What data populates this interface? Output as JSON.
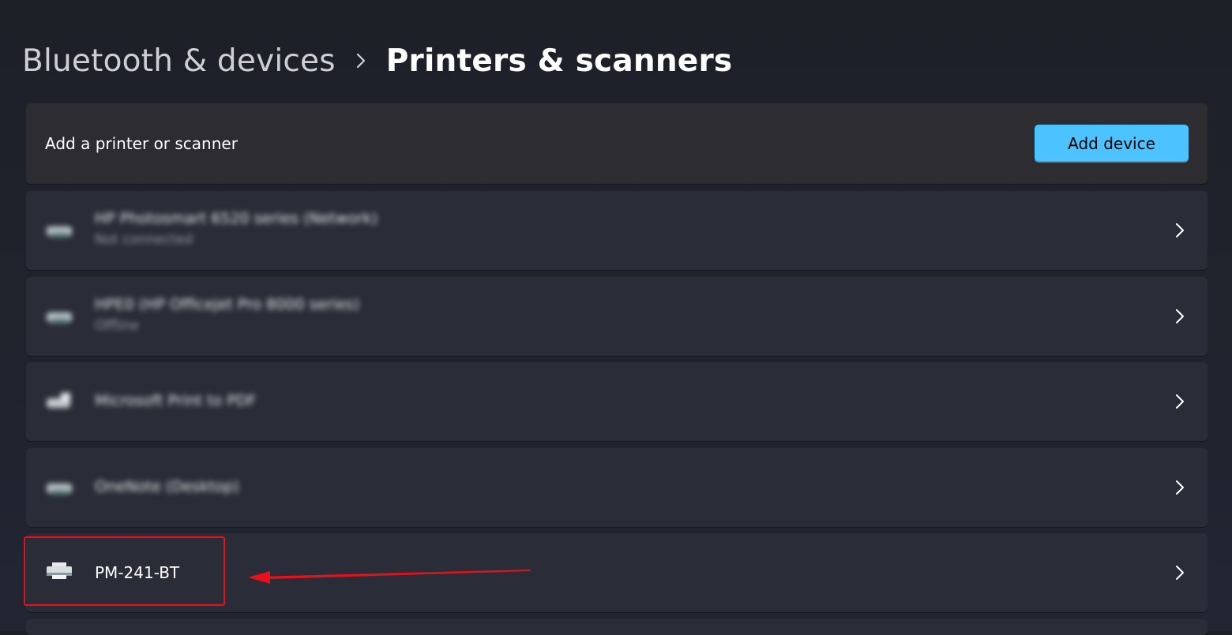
{
  "breadcrumb": {
    "parent": "Bluetooth & devices",
    "current": "Printers & scanners"
  },
  "add_section": {
    "label": "Add a printer or scanner",
    "button_label": "Add device",
    "accent": "#4cc2ff"
  },
  "printers": [
    {
      "name": "HP Photosmart 6520 series (Network)",
      "status": "Not connected",
      "icon": "printer-icon"
    },
    {
      "name": "HPE0 (HP Officejet Pro 8000 series)",
      "status": "Offline",
      "icon": "printer-icon"
    },
    {
      "name": "Microsoft Print to PDF",
      "status": "",
      "icon": "printer-icon"
    },
    {
      "name": "OneNote (Desktop)",
      "status": "",
      "icon": "printer-icon"
    },
    {
      "name": "PM-241-BT",
      "status": "",
      "icon": "printer-icon"
    }
  ],
  "annotation": {
    "color": "#e8101a",
    "arrow_icon": "red-arrow-pointing-left"
  }
}
